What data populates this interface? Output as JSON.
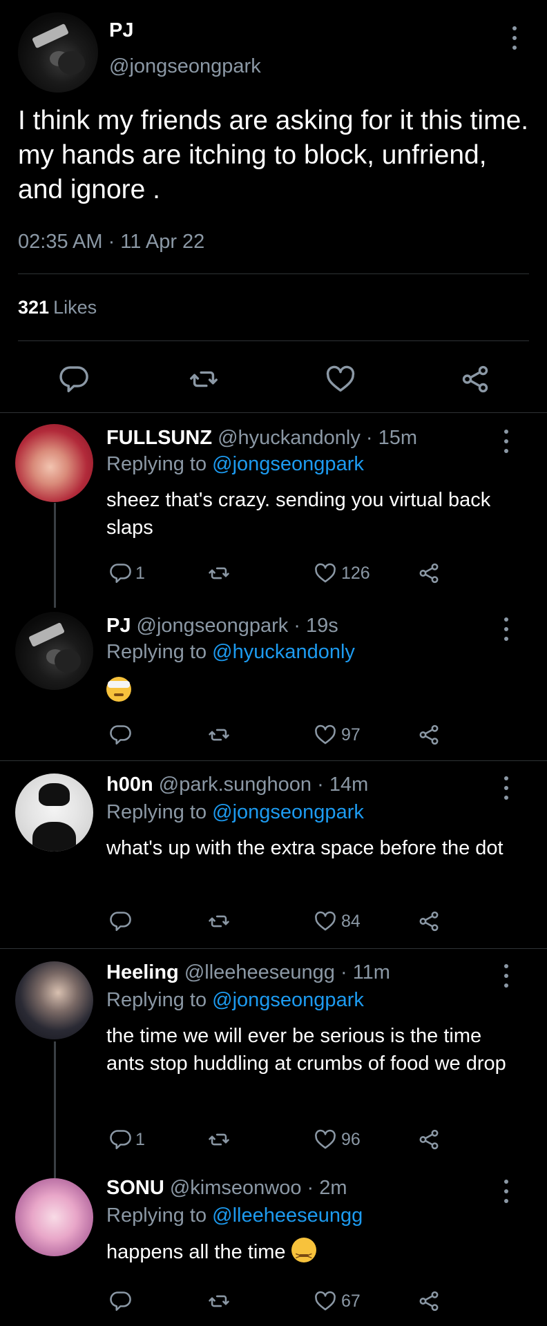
{
  "main_tweet": {
    "name": "PJ",
    "handle": "@jongseongpark",
    "text": "I think my friends are asking for it this time. my hands are itching to block, unfriend, and ignore .",
    "timestamp": "02:35 AM · 11 Apr 22",
    "likes_count": "321",
    "likes_label": "Likes",
    "icons": [
      "reply-icon",
      "retweet-icon",
      "like-icon",
      "share-icon",
      "more-icon"
    ]
  },
  "replies": [
    {
      "name": "FULLSUNZ",
      "meta": "@hyuckandonly · 15m",
      "replying_prefix": "Replying to",
      "replying_to": "@jongseongpark",
      "text": "sheez that's crazy. sending you virtual back slaps",
      "reply_count": "1",
      "like_count": "126"
    },
    {
      "name": "PJ",
      "meta": "@jongseongpark · 19s",
      "replying_prefix": "Replying to",
      "replying_to": "@hyuckandonly",
      "text": "",
      "emoji": "face-with-head-bandage",
      "reply_count": "",
      "like_count": "97"
    },
    {
      "name": "h00n",
      "meta": "@park.sunghoon · 14m",
      "replying_prefix": "Replying to",
      "replying_to": "@jongseongpark",
      "text": "what's up with the extra space before the dot",
      "reply_count": "",
      "like_count": "84"
    },
    {
      "name": "Heeling",
      "meta": "@lleeheeseungg · 11m",
      "replying_prefix": "Replying to",
      "replying_to": "@jongseongpark",
      "text": "the time we will ever be serious is the time ants stop huddling at crumbs of food we drop",
      "reply_count": "1",
      "like_count": "96"
    },
    {
      "name": "SONU",
      "meta": "@kimseonwoo · 2m",
      "replying_prefix": "Replying to",
      "replying_to": "@lleeheeseungg",
      "text": "happens all the time",
      "emoji": "confounded-face",
      "reply_count": "",
      "like_count": "67"
    }
  ],
  "colors": {
    "background": "#000000",
    "text": "#ffffff",
    "secondary": "#8b98a5",
    "link": "#1d9bf0",
    "divider": "#2f3336"
  }
}
